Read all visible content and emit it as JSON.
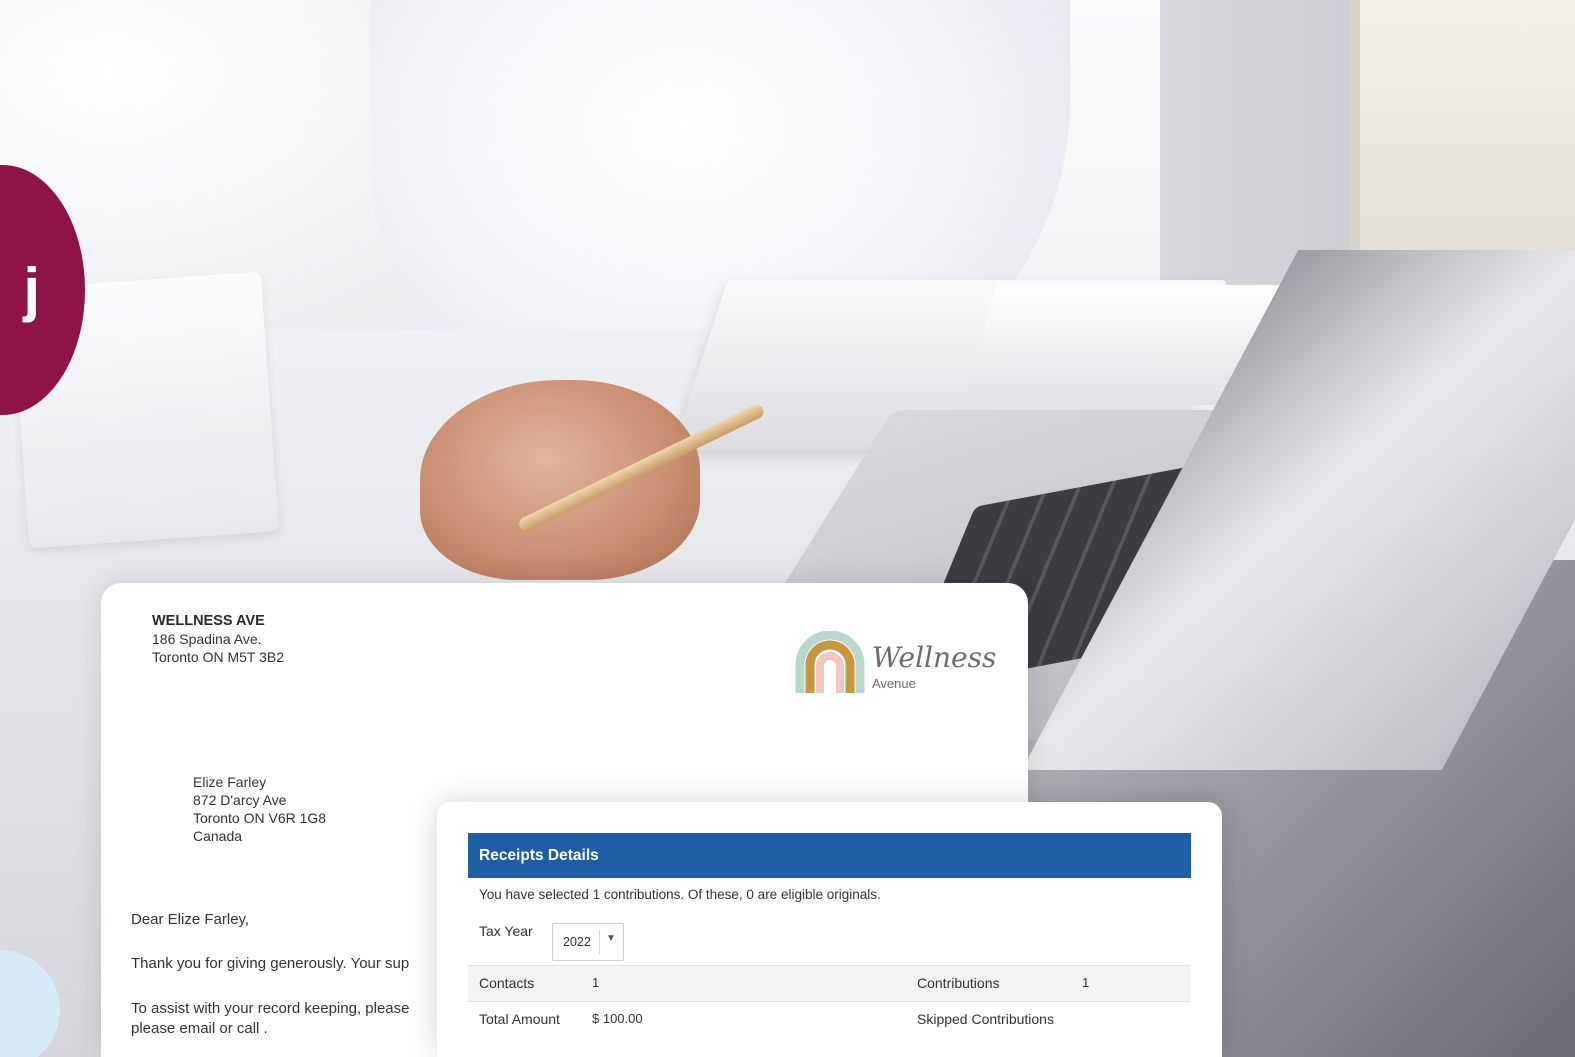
{
  "brand": {
    "accent": "#8e1447",
    "badge_glyph": "j"
  },
  "letter": {
    "org_name": "WELLNESS AVE",
    "org_address_1": "186 Spadina Ave.",
    "org_address_2": "Toronto ON M5T 3B2",
    "logo_text": "Wellness",
    "logo_subtext": "Avenue",
    "recipient_name": "Elize Farley",
    "recipient_address_1": "872 D'arcy Ave",
    "recipient_address_2": "Toronto ON V6R 1G8",
    "recipient_country": "Canada",
    "salutation": "Dear Elize Farley,",
    "para1": "Thank you for giving generously. Your sup",
    "para2_line1": "To assist with your record keeping, please",
    "para2_line2": "please email  or call ."
  },
  "receipts": {
    "header_color": "#1e5fa4",
    "title": "Receipts Details",
    "selected_info": "You have selected 1 contributions. Of these, 0 are eligible originals.",
    "tax_year_label": "Tax Year",
    "tax_year_value": "2022",
    "rows": [
      {
        "label_left": "Contacts",
        "value_left": "1",
        "label_right": "Contributions",
        "value_right": "1"
      },
      {
        "label_left": "Total Amount",
        "value_left": "$ 100.00",
        "label_right": "Skipped Contributions",
        "value_right": ""
      }
    ]
  }
}
